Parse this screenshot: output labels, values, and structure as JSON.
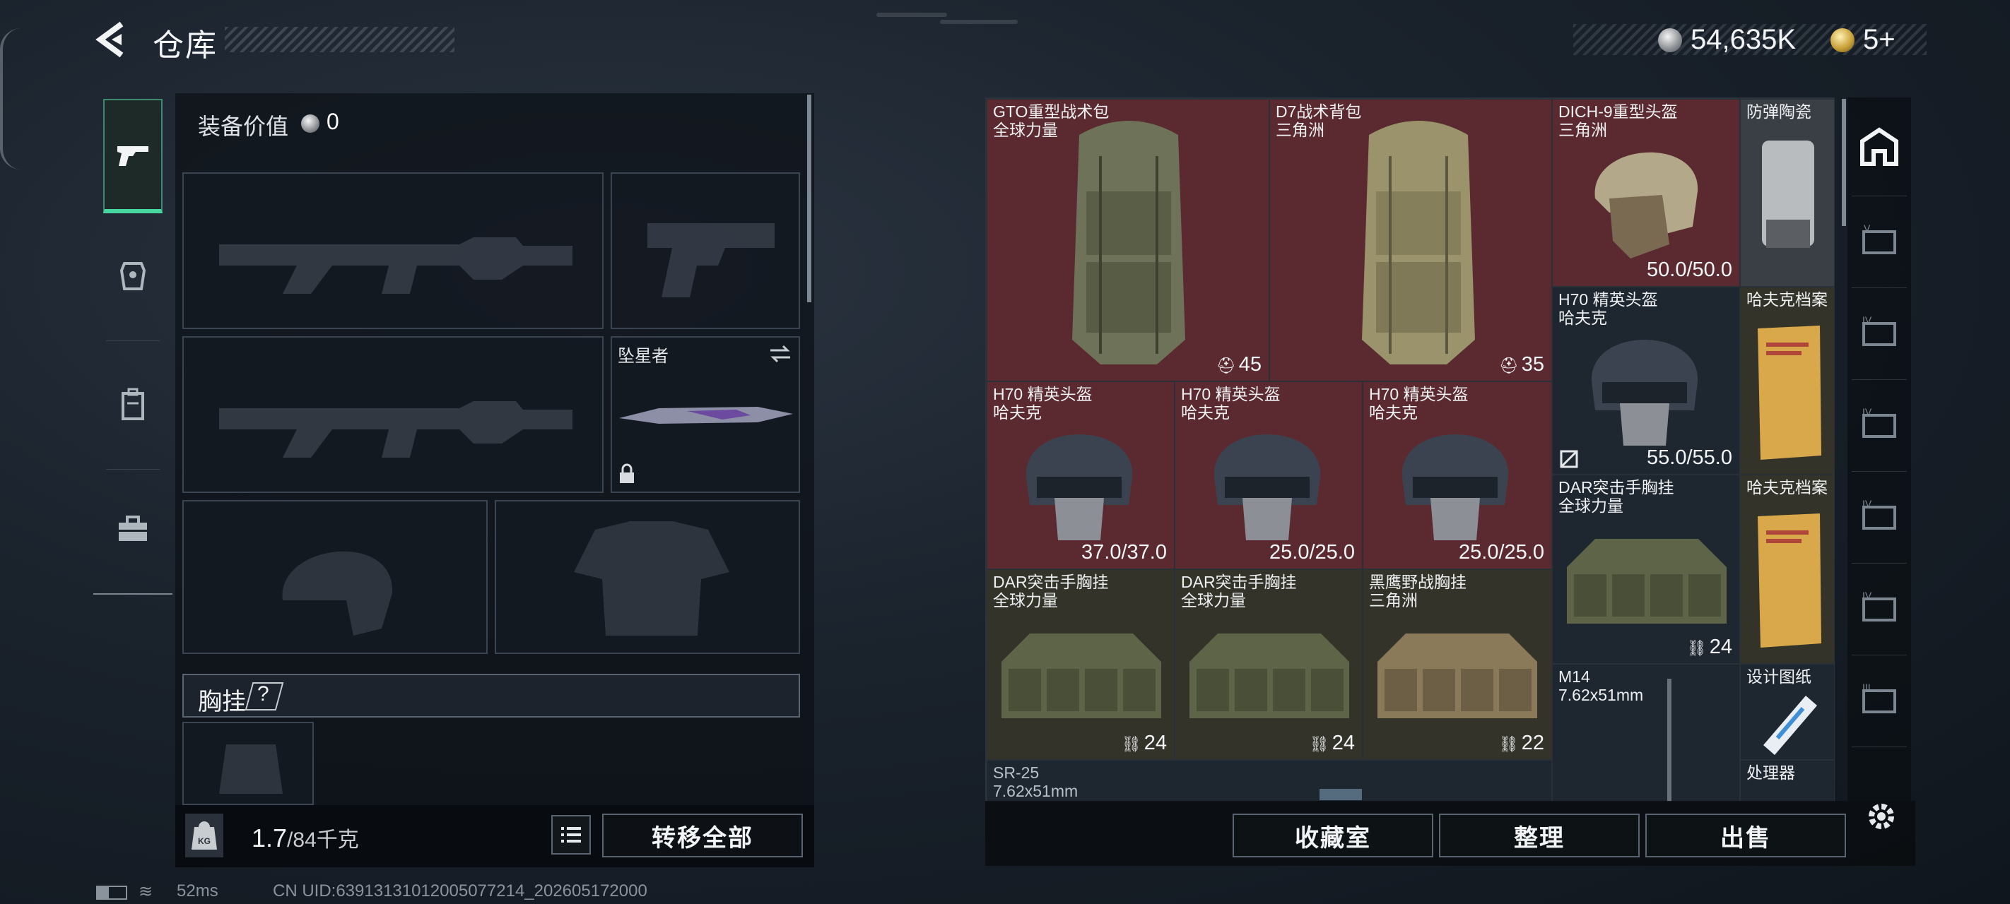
{
  "header": {
    "title": "仓库"
  },
  "currency": {
    "silver": "54,635K",
    "gold": "5+"
  },
  "equipment": {
    "value_label": "装备价值",
    "value": "0",
    "melee_name": "坠星者",
    "chest_label": "胸挂",
    "chest_help": "?",
    "weight_current": "1.7",
    "weight_max": "/84千克",
    "transfer_all": "转移全部"
  },
  "stash": {
    "items": [
      {
        "name": "GTO重型战术包\n全球力量",
        "count": "45"
      },
      {
        "name": "D7战术背包\n三角洲",
        "count": "35"
      },
      {
        "name": "DICH-9重型头盔\n三角洲",
        "durability": "50.0/50.0"
      },
      {
        "name": "防弹陶瓷"
      },
      {
        "name": "H70 精英头盔\n哈夫克",
        "durability": "55.0/55.0"
      },
      {
        "name": "哈夫克档案"
      },
      {
        "name": "H70 精英头盔\n哈夫克",
        "durability": "37.0/37.0"
      },
      {
        "name": "H70 精英头盔\n哈夫克",
        "durability": "25.0/25.0"
      },
      {
        "name": "H70 精英头盔\n哈夫克",
        "durability": "25.0/25.0"
      },
      {
        "name": "DAR突击手胸挂\n全球力量",
        "count": "24"
      },
      {
        "name": "哈夫克档案"
      },
      {
        "name": "DAR突击手胸挂\n全球力量",
        "count": "24"
      },
      {
        "name": "DAR突击手胸挂\n全球力量",
        "count": "24"
      },
      {
        "name": "黑鹰野战胸挂\n三角洲",
        "count": "22"
      },
      {
        "name": "M14\n7.62x51mm"
      },
      {
        "name": "设计图纸"
      },
      {
        "name": "SR-25\n7.62x51mm"
      },
      {
        "name": "处理器"
      }
    ]
  },
  "actions": {
    "collection": "收藏室",
    "sort": "整理",
    "sell": "出售"
  },
  "status": {
    "ping": "52ms",
    "uid": "CN UID:6391313101200507721­4_202605172000"
  }
}
